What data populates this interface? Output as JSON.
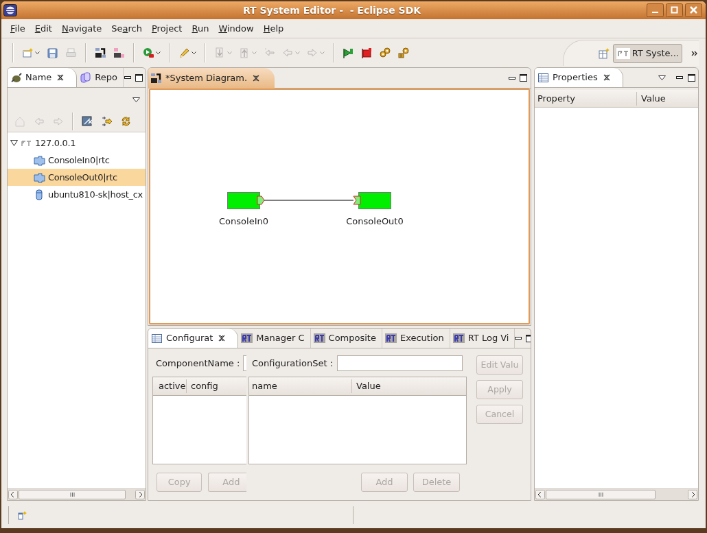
{
  "window": {
    "title": "RT System Editor -  - Eclipse SDK"
  },
  "menu": [
    {
      "mnemonic": "F",
      "rest": "ile"
    },
    {
      "mnemonic": "E",
      "rest": "dit"
    },
    {
      "mnemonic": "N",
      "rest": "avigate"
    },
    {
      "before": "Se",
      "mnemonic": "a",
      "rest": "rch"
    },
    {
      "mnemonic": "P",
      "rest": "roject"
    },
    {
      "mnemonic": "R",
      "rest": "un"
    },
    {
      "mnemonic": "W",
      "rest": "indow"
    },
    {
      "mnemonic": "H",
      "rest": "elp"
    }
  ],
  "toolbar": [
    {
      "kind": "separator"
    },
    {
      "kind": "new",
      "disabled": false,
      "dropdown": true
    },
    {
      "kind": "save",
      "disabled": false,
      "dropdown": false
    },
    {
      "kind": "print",
      "disabled": true,
      "dropdown": false
    },
    {
      "kind": "separator"
    },
    {
      "kind": "power-on",
      "disabled": false,
      "dropdown": false
    },
    {
      "kind": "power-off",
      "disabled": false,
      "dropdown": false
    },
    {
      "kind": "separator"
    },
    {
      "kind": "run",
      "disabled": false,
      "dropdown": true
    },
    {
      "kind": "separator"
    },
    {
      "kind": "pencil",
      "disabled": false,
      "dropdown": true
    },
    {
      "kind": "separator"
    },
    {
      "kind": "down",
      "disabled": true,
      "dropdown": true
    },
    {
      "kind": "up",
      "disabled": true,
      "dropdown": true
    },
    {
      "kind": "last-edit",
      "disabled": true,
      "dropdown": false
    },
    {
      "kind": "back",
      "disabled": true,
      "dropdown": true
    },
    {
      "kind": "forward",
      "disabled": true,
      "dropdown": true
    },
    {
      "kind": "separator"
    },
    {
      "kind": "flag-green",
      "disabled": false,
      "dropdown": false
    },
    {
      "kind": "flag-red",
      "disabled": false,
      "dropdown": false
    },
    {
      "kind": "gears",
      "disabled": false,
      "dropdown": false
    },
    {
      "kind": "gears-split",
      "disabled": false,
      "dropdown": false
    }
  ],
  "perspective": {
    "label": "RT Syste...",
    "selected": true
  },
  "explorer": {
    "tabs": [
      {
        "label": "Name",
        "kind": "plug",
        "selected": true
      },
      {
        "label": "Repo",
        "kind": "database",
        "selected": false
      }
    ],
    "toolbar": [
      {
        "kind": "home",
        "disabled": true
      },
      {
        "kind": "back",
        "disabled": true
      },
      {
        "kind": "forward",
        "disabled": true
      },
      {
        "kind": "separator"
      },
      {
        "kind": "edit",
        "disabled": false
      },
      {
        "kind": "filter",
        "disabled": false
      },
      {
        "kind": "refresh",
        "disabled": false
      }
    ],
    "tree": [
      {
        "label": "127.0.0.1",
        "kind": "server",
        "expanded": true,
        "selected": false,
        "children": [
          {
            "label": "ConsoleIn0|rtc",
            "kind": "component",
            "selected": false
          },
          {
            "label": "ConsoleOut0|rtc",
            "kind": "component",
            "selected": true
          },
          {
            "label": "ubuntu810-sk|host_cx",
            "kind": "host",
            "selected": false
          }
        ]
      }
    ]
  },
  "editor": {
    "tab": {
      "label": "*System Diagram.",
      "selected": true
    },
    "components": [
      {
        "name": "ConsoleIn0",
        "color": "#00ee00",
        "kind": "source"
      },
      {
        "name": "ConsoleOut0",
        "color": "#00ee00",
        "kind": "sink"
      }
    ]
  },
  "bottom": {
    "tabs": [
      {
        "label": "Configurat",
        "kind": "table",
        "selected": true
      },
      {
        "label": "Manager C",
        "kind": "rt",
        "selected": false
      },
      {
        "label": "Composite",
        "kind": "rt",
        "selected": false
      },
      {
        "label": "Execution",
        "kind": "rt",
        "selected": false
      },
      {
        "label": "RT Log Vi",
        "kind": "rt",
        "selected": false
      }
    ],
    "component_name_label": "ComponentName :",
    "configuration_set_label": "ConfigurationSet :",
    "sets_table": {
      "columns": [
        "active",
        "config"
      ]
    },
    "params_table": {
      "columns": [
        "name",
        "Value"
      ]
    },
    "sets_buttons": [
      {
        "label": "Copy",
        "disabled": true
      },
      {
        "label": "Add",
        "disabled": true
      }
    ],
    "params_buttons": [
      {
        "label": "Add",
        "disabled": true
      },
      {
        "label": "Delete",
        "disabled": true
      }
    ],
    "side_buttons": [
      {
        "label": "Edit Valu",
        "disabled": true
      },
      {
        "label": "Apply",
        "disabled": true
      },
      {
        "label": "Cancel",
        "disabled": true
      }
    ]
  },
  "properties": {
    "tab": {
      "label": "Properties",
      "selected": true
    },
    "columns": [
      "Property",
      "Value"
    ]
  }
}
